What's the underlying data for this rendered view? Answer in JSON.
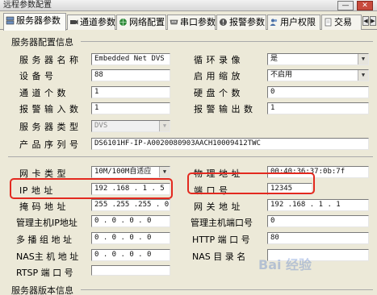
{
  "window": {
    "title": "远程参数配置",
    "min_label": "—",
    "close_label": "✕"
  },
  "tabs": [
    {
      "label": "服务器参数",
      "icon": "server-icon",
      "active": true
    },
    {
      "label": "通道参数",
      "icon": "camera-icon"
    },
    {
      "label": "网络配置",
      "icon": "globe-icon"
    },
    {
      "label": "串口参数",
      "icon": "serial-port-icon"
    },
    {
      "label": "报警参数",
      "icon": "alarm-icon"
    },
    {
      "label": "用户权限",
      "icon": "users-icon"
    },
    {
      "label": "交易",
      "icon": "document-icon"
    }
  ],
  "server_config": {
    "group_title": "服务器配置信息",
    "server_name_label": "服 务 器 名 称",
    "server_name": "Embedded Net DVS",
    "device_no_label": "设    备    号",
    "device_no": "88",
    "channel_count_label": "通  道  个  数",
    "channel_count": "1",
    "alarm_in_label": "报 警 输 入 数",
    "alarm_in": "1",
    "server_type_label": "服 务 器 类 型",
    "server_type": "DVS",
    "serial_label": "产 品 序 列 号",
    "serial": "DS6101HF-IP-A0020080903AACH10009412TWC",
    "loop_record_label": "循  环  录  像",
    "loop_record": "是",
    "scaling_label": "启  用  缩  放",
    "scaling": "不启用",
    "disk_count_label": "硬  盘  个  数",
    "disk_count": "0",
    "alarm_out_label": "报 警 输 出 数",
    "alarm_out": "1"
  },
  "network": {
    "nic_type_label": "网  卡  类  型",
    "nic_type": "10M/100M自适应",
    "ip_label": "IP    地    址",
    "ip": "192 .168 . 1 . 5",
    "mask_label": "掩  码  地  址",
    "mask": "255 .255 .255 . 0",
    "mgmt_ip_label": "管理主机IP地址",
    "mgmt_ip": "0 . 0 . 0 . 0",
    "multicast_label": "多  播  组  地  址",
    "multicast": "0 . 0 . 0 . 0",
    "nas_label": "NAS主 机 地 址",
    "nas": "0 . 0 . 0 . 0",
    "rtsp_label": "RTSP  端  口  号",
    "rtsp": "",
    "mac_label": "物  理  地  址",
    "mac": "00:40:36:37:0b:7f",
    "port_label": "端    口    号",
    "port": "12345",
    "gateway_label": "网  关  地  址",
    "gateway": "192 .168 . 1 . 1",
    "mgmt_port_label": "管理主机端口号",
    "mgmt_port": "0",
    "http_port_label": "HTTP  端  口  号",
    "http_port": "80",
    "nas_dir_label": "NAS  目  录  名",
    "nas_dir": ""
  },
  "version": {
    "group_title": "服务器版本信息"
  },
  "highlight_color": "#e3291f",
  "watermark": "Bai 经验"
}
